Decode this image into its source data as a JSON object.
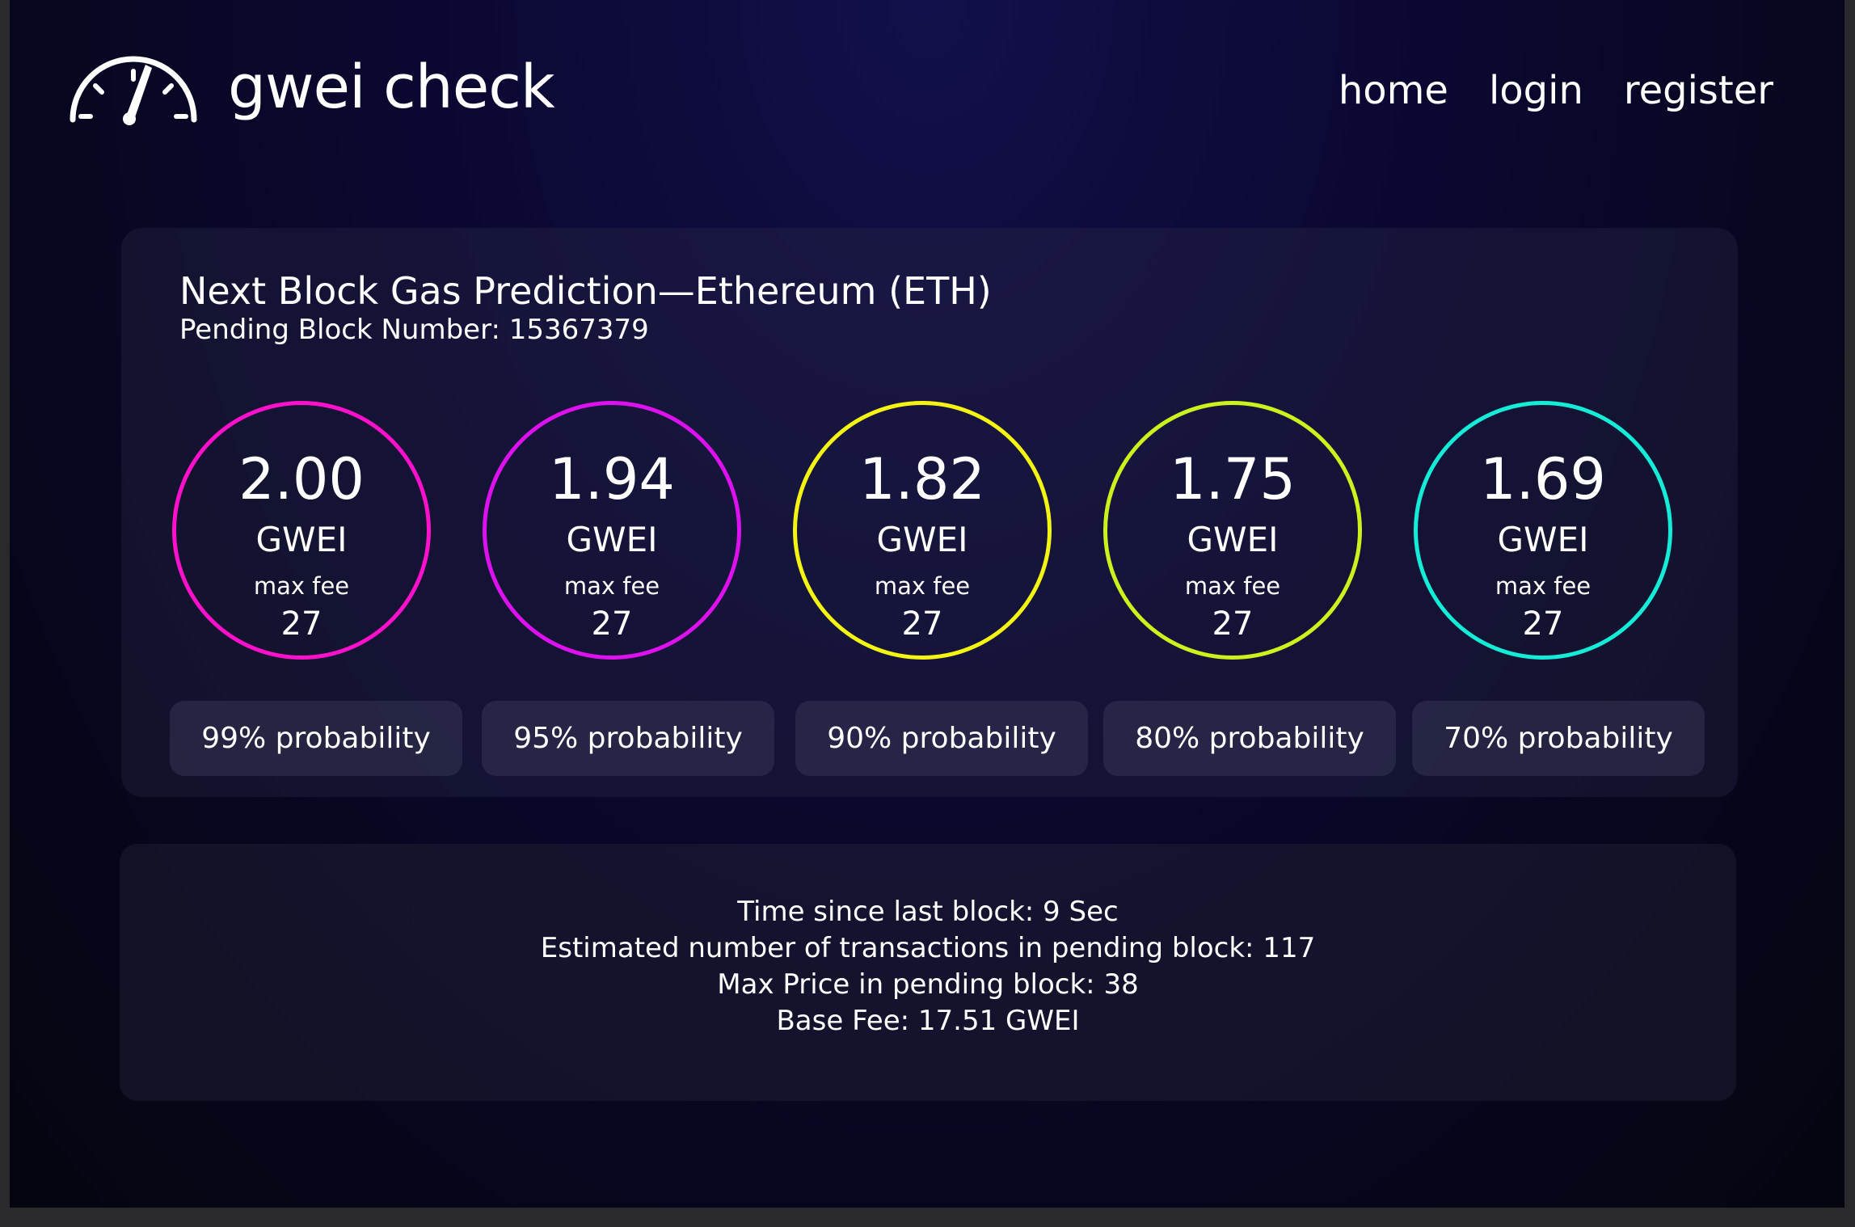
{
  "header": {
    "brand": "gwei check",
    "logo_icon": "speedometer-icon",
    "nav": [
      {
        "label": "home"
      },
      {
        "label": "login"
      },
      {
        "label": "register"
      }
    ]
  },
  "prediction": {
    "title": "Next Block Gas Prediction—Ethereum (ETH)",
    "pending_block": "Pending Block Number: 15367379",
    "tiers": [
      {
        "value": "2.00",
        "unit": "GWEI",
        "label": "max fee",
        "count": "27",
        "probability": "99% probability",
        "color": "#ff11cc"
      },
      {
        "value": "1.94",
        "unit": "GWEI",
        "label": "max fee",
        "count": "27",
        "probability": "95% probability",
        "color": "#dd11ee"
      },
      {
        "value": "1.82",
        "unit": "GWEI",
        "label": "max fee",
        "count": "27",
        "probability": "90% probability",
        "color": "#f4f414"
      },
      {
        "value": "1.75",
        "unit": "GWEI",
        "label": "max fee",
        "count": "27",
        "probability": "80% probability",
        "color": "#ccf21e"
      },
      {
        "value": "1.69",
        "unit": "GWEI",
        "label": "max fee",
        "count": "27",
        "probability": "70% probability",
        "color": "#14ecd8"
      }
    ]
  },
  "stats": {
    "lines": [
      "Time since last block: 9 Sec",
      "Estimated number of transactions in pending block: 117",
      "Max Price in pending block: 38",
      "Base Fee: 17.51 GWEI"
    ]
  }
}
